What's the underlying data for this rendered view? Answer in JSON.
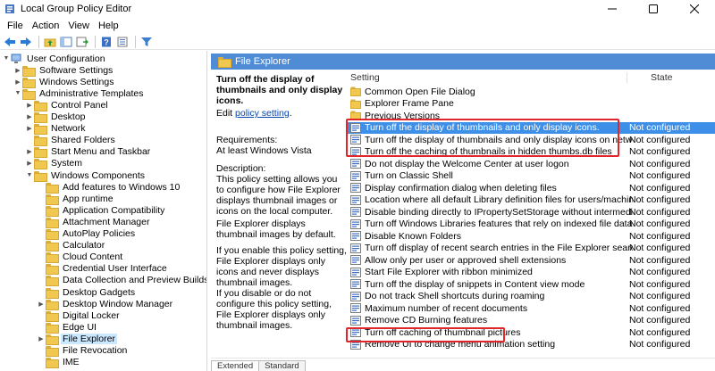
{
  "window": {
    "title": "Local Group Policy Editor"
  },
  "menu": [
    "File",
    "Action",
    "View",
    "Help"
  ],
  "tree": [
    {
      "label": "User Configuration",
      "indent": 0,
      "expanded": true,
      "icon": "computer"
    },
    {
      "label": "Software Settings",
      "indent": 1,
      "expanded": false
    },
    {
      "label": "Windows Settings",
      "indent": 1,
      "expanded": false
    },
    {
      "label": "Administrative Templates",
      "indent": 1,
      "expanded": true
    },
    {
      "label": "Control Panel",
      "indent": 2,
      "expanded": false
    },
    {
      "label": "Desktop",
      "indent": 2,
      "expanded": false
    },
    {
      "label": "Network",
      "indent": 2,
      "expanded": false
    },
    {
      "label": "Shared Folders",
      "indent": 2
    },
    {
      "label": "Start Menu and Taskbar",
      "indent": 2,
      "expanded": false
    },
    {
      "label": "System",
      "indent": 2,
      "expanded": false
    },
    {
      "label": "Windows Components",
      "indent": 2,
      "expanded": true
    },
    {
      "label": "Add features to Windows 10",
      "indent": 3
    },
    {
      "label": "App runtime",
      "indent": 3
    },
    {
      "label": "Application Compatibility",
      "indent": 3
    },
    {
      "label": "Attachment Manager",
      "indent": 3
    },
    {
      "label": "AutoPlay Policies",
      "indent": 3
    },
    {
      "label": "Calculator",
      "indent": 3
    },
    {
      "label": "Cloud Content",
      "indent": 3
    },
    {
      "label": "Credential User Interface",
      "indent": 3
    },
    {
      "label": "Data Collection and Preview Builds",
      "indent": 3
    },
    {
      "label": "Desktop Gadgets",
      "indent": 3
    },
    {
      "label": "Desktop Window Manager",
      "indent": 3,
      "expanded": false
    },
    {
      "label": "Digital Locker",
      "indent": 3
    },
    {
      "label": "Edge UI",
      "indent": 3
    },
    {
      "label": "File Explorer",
      "indent": 3,
      "expanded": false,
      "selected": true
    },
    {
      "label": "File Revocation",
      "indent": 3
    },
    {
      "label": "IME",
      "indent": 3
    }
  ],
  "pane": {
    "header": "File Explorer",
    "desc_title": "Turn off the display of thumbnails and only display icons.",
    "edit_prefix": "Edit ",
    "edit_link": "policy setting",
    "edit_suffix": ".",
    "req_label": "Requirements:",
    "req_value": "At least Windows Vista",
    "desc_label": "Description:",
    "desc_p1": "This policy setting allows you to configure how File Explorer displays thumbnail images or icons on the local computer.",
    "desc_p2": "File Explorer displays thumbnail images by default.",
    "desc_p3": "If you enable this policy setting, File Explorer displays only icons and never displays thumbnail images.",
    "desc_p4": "If you disable or do not configure this policy setting, File Explorer displays only thumbnail images."
  },
  "columns": {
    "setting": "Setting",
    "state": "State"
  },
  "settings": [
    {
      "name": "Common Open File Dialog",
      "type": "folder",
      "state": ""
    },
    {
      "name": "Explorer Frame Pane",
      "type": "folder",
      "state": ""
    },
    {
      "name": "Previous Versions",
      "type": "folder",
      "state": ""
    },
    {
      "name": "Turn off the display of thumbnails and only display icons.",
      "type": "policy",
      "state": "Not configured",
      "selected": true
    },
    {
      "name": "Turn off the display of thumbnails and only display icons on network folders",
      "type": "policy",
      "state": "Not configured"
    },
    {
      "name": "Turn off the caching of thumbnails in hidden thumbs.db files",
      "type": "policy",
      "state": "Not configured"
    },
    {
      "name": "Do not display the Welcome Center at user logon",
      "type": "policy",
      "state": "Not configured"
    },
    {
      "name": "Turn on Classic Shell",
      "type": "policy",
      "state": "Not configured"
    },
    {
      "name": "Display confirmation dialog when deleting files",
      "type": "policy",
      "state": "Not configured"
    },
    {
      "name": "Location where all default Library definition files for users/machines reside.",
      "type": "policy",
      "state": "Not configured"
    },
    {
      "name": "Disable binding directly to IPropertySetStorage without intermediate layers.",
      "type": "policy",
      "state": "Not configured"
    },
    {
      "name": "Turn off Windows Libraries features that rely on indexed file data",
      "type": "policy",
      "state": "Not configured"
    },
    {
      "name": "Disable Known Folders",
      "type": "policy",
      "state": "Not configured"
    },
    {
      "name": "Turn off display of recent search entries in the File Explorer search box",
      "type": "policy",
      "state": "Not configured"
    },
    {
      "name": "Allow only per user or approved shell extensions",
      "type": "policy",
      "state": "Not configured"
    },
    {
      "name": "Start File Explorer with ribbon minimized",
      "type": "policy",
      "state": "Not configured"
    },
    {
      "name": "Turn off the display of snippets in Content view mode",
      "type": "policy",
      "state": "Not configured"
    },
    {
      "name": "Do not track Shell shortcuts during roaming",
      "type": "policy",
      "state": "Not configured"
    },
    {
      "name": "Maximum number of recent documents",
      "type": "policy",
      "state": "Not configured"
    },
    {
      "name": "Remove CD Burning features",
      "type": "policy",
      "state": "Not configured"
    },
    {
      "name": "Turn off caching of thumbnail pictures",
      "type": "policy",
      "state": "Not configured"
    },
    {
      "name": "Remove UI to change menu animation setting",
      "type": "policy",
      "state": "Not configured"
    }
  ],
  "tabs": [
    "Extended",
    "Standard"
  ],
  "accent": {
    "header": "#4f8cd5",
    "selection": "#3d8fe8",
    "highlight": "#e0262b"
  }
}
